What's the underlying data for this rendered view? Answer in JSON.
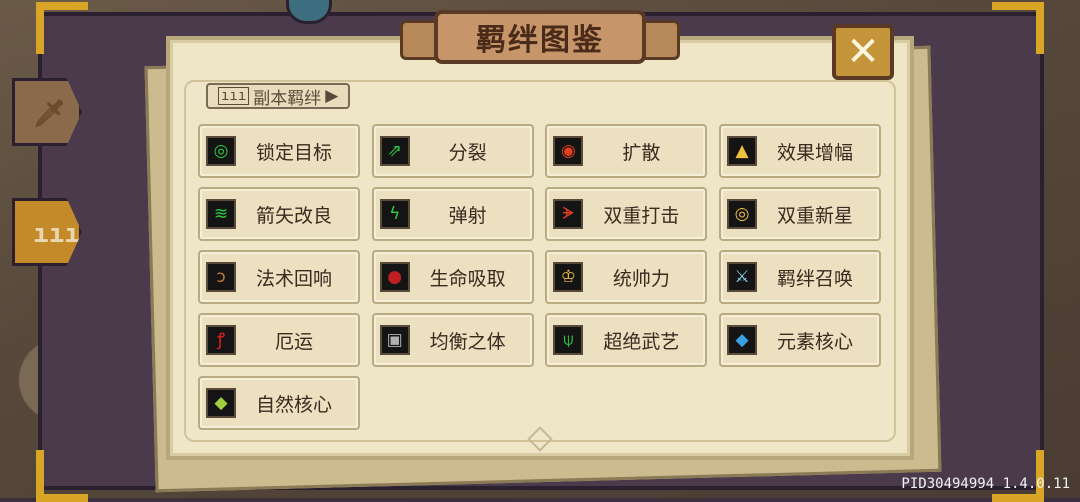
{
  "title": "羁绊图鉴",
  "close_label": "✕",
  "sub_tab": {
    "icon": "ııı",
    "label": "副本羁绊"
  },
  "side_tabs": [
    {
      "icon": "sword-icon",
      "glyph": "🗡"
    },
    {
      "icon": "bars-icon",
      "glyph": "ııı"
    }
  ],
  "bonds": [
    {
      "label": "锁定目标",
      "icon": "target-icon",
      "glyph": "◎",
      "color": "#2ecc40"
    },
    {
      "label": "分裂",
      "icon": "split-arrows-icon",
      "glyph": "⇗",
      "color": "#2ecc40"
    },
    {
      "label": "扩散",
      "icon": "ripple-icon",
      "glyph": "◉",
      "color": "#e04020"
    },
    {
      "label": "效果增幅",
      "icon": "flame-boost-icon",
      "glyph": "▲",
      "color": "#f0c040"
    },
    {
      "label": "箭矢改良",
      "icon": "arrows-icon",
      "glyph": "≋",
      "color": "#2ecc40"
    },
    {
      "label": "弹射",
      "icon": "lightning-icon",
      "glyph": "ϟ",
      "color": "#2ecc40"
    },
    {
      "label": "双重打击",
      "icon": "bow-icon",
      "glyph": "ᗘ",
      "color": "#e04020"
    },
    {
      "label": "双重新星",
      "icon": "nova-icon",
      "glyph": "◎",
      "color": "#f0c040"
    },
    {
      "label": "法术回响",
      "icon": "staff-icon",
      "glyph": "ↄ",
      "color": "#c07a30"
    },
    {
      "label": "生命吸取",
      "icon": "skull-icon",
      "glyph": "●",
      "color": "#c02020"
    },
    {
      "label": "统帅力",
      "icon": "trophy-icon",
      "glyph": "♔",
      "color": "#f0c040"
    },
    {
      "label": "羁绊召唤",
      "icon": "sword-summon-icon",
      "glyph": "⚔",
      "color": "#8ad0f0"
    },
    {
      "label": "厄运",
      "icon": "curse-icon",
      "glyph": "ꝭ",
      "color": "#e02020"
    },
    {
      "label": "均衡之体",
      "icon": "shield-icon",
      "glyph": "▣",
      "color": "#b0b0b0"
    },
    {
      "label": "超绝武艺",
      "icon": "emblem-icon",
      "glyph": "⍦",
      "color": "#2ecc40"
    },
    {
      "label": "元素核心",
      "icon": "crystal-icon",
      "glyph": "◆",
      "color": "#3aa0e0"
    },
    {
      "label": "自然核心",
      "icon": "nature-gem-icon",
      "glyph": "◆",
      "color": "#a0d040"
    }
  ],
  "version": "PID30494994 1.4.0.11"
}
